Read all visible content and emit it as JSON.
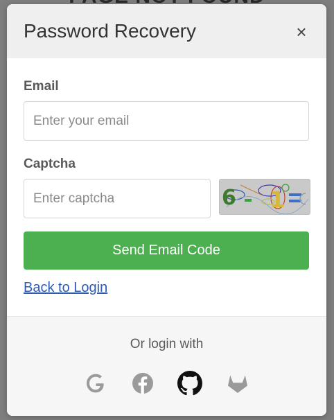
{
  "background": {
    "heading": "PAGE NOT FOUND"
  },
  "modal": {
    "title": "Password Recovery",
    "close_glyph": "×"
  },
  "form": {
    "email_label": "Email",
    "email_placeholder": "Enter your email",
    "email_value": "",
    "captcha_label": "Captcha",
    "captcha_placeholder": "Enter captcha",
    "captcha_value": "",
    "captcha_image_text": "6 - 1 =",
    "submit_label": "Send Email Code",
    "back_link": "Back to Login"
  },
  "footer": {
    "or_text": "Or login with",
    "providers": [
      {
        "name": "google",
        "icon": "google-icon"
      },
      {
        "name": "facebook",
        "icon": "facebook-icon"
      },
      {
        "name": "github",
        "icon": "github-icon"
      },
      {
        "name": "gitlab",
        "icon": "gitlab-icon"
      }
    ]
  },
  "colors": {
    "primary_button": "#4caf50",
    "link": "#2f5bb3",
    "header_bg": "#efefef",
    "overlay": "#7f7f7f"
  }
}
